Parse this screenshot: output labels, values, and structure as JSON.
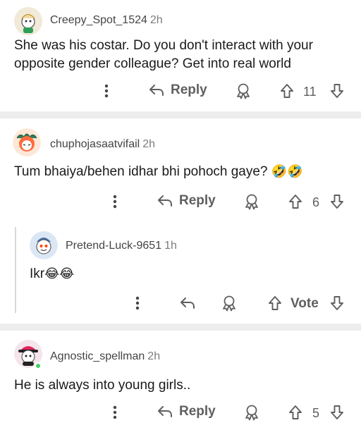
{
  "comments": [
    {
      "username": "Creepy_Spot_1524",
      "age": "2h",
      "body_line1": "She was his costar. Do you don't interact with your",
      "body_line2": "opposite gender colleague? Get into real world",
      "reply_label": "Reply",
      "vote_count": "11"
    },
    {
      "username": "chuphojasaatvifail",
      "age": "2h",
      "body": "Tum bhaiya/behen idhar bhi pohoch gaye?",
      "body_emoji": "🤣🤣",
      "reply_label": "Reply",
      "vote_count": "6"
    },
    {
      "username": "Pretend-Luck-9651",
      "age": "1h",
      "body": "Ikr",
      "body_emoji": "😂😂",
      "vote_label": "Vote"
    },
    {
      "username": "Agnostic_spellman",
      "age": "2h",
      "body": "He is always into young girls..",
      "reply_label": "Reply",
      "vote_count": "5"
    }
  ],
  "colors": {
    "divider": "#ededed",
    "text": "#1a1a1b",
    "muted": "#5f5f5f",
    "online": "#46d160"
  },
  "icons": [
    "more-vertical-icon",
    "reply-arrow-icon",
    "award-icon",
    "upvote-arrow-icon",
    "downvote-arrow-icon"
  ]
}
